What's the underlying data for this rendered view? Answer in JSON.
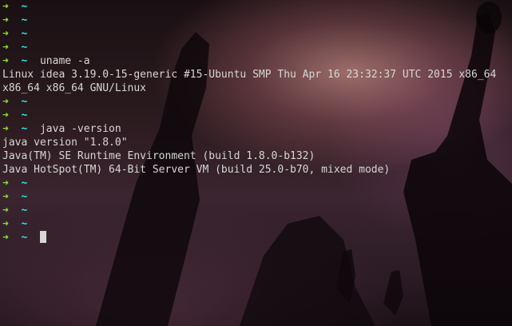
{
  "colors": {
    "prompt_arrow": "#8ae234",
    "prompt_dir": "#34e2e2",
    "text": "#d7d7d3",
    "cursor": "#d7d7d3"
  },
  "prompt": {
    "arrow": "➜",
    "dir": "~"
  },
  "lines": [
    {
      "kind": "prompt",
      "command": ""
    },
    {
      "kind": "prompt",
      "command": ""
    },
    {
      "kind": "prompt",
      "command": ""
    },
    {
      "kind": "prompt",
      "command": ""
    },
    {
      "kind": "prompt",
      "command": "uname -a"
    },
    {
      "kind": "output",
      "text": "Linux idea 3.19.0-15-generic #15-Ubuntu SMP Thu Apr 16 23:32:37 UTC 2015 x86_64"
    },
    {
      "kind": "output",
      "text": "x86_64 x86_64 GNU/Linux"
    },
    {
      "kind": "prompt",
      "command": ""
    },
    {
      "kind": "prompt",
      "command": ""
    },
    {
      "kind": "prompt",
      "command": "java -version"
    },
    {
      "kind": "output",
      "text": "java version \"1.8.0\""
    },
    {
      "kind": "output",
      "text": "Java(TM) SE Runtime Environment (build 1.8.0-b132)"
    },
    {
      "kind": "output",
      "text": "Java HotSpot(TM) 64-Bit Server VM (build 25.0-b70, mixed mode)"
    },
    {
      "kind": "prompt",
      "command": ""
    },
    {
      "kind": "prompt",
      "command": ""
    },
    {
      "kind": "prompt",
      "command": ""
    },
    {
      "kind": "prompt",
      "command": ""
    },
    {
      "kind": "prompt",
      "command": "",
      "cursor": true
    }
  ]
}
